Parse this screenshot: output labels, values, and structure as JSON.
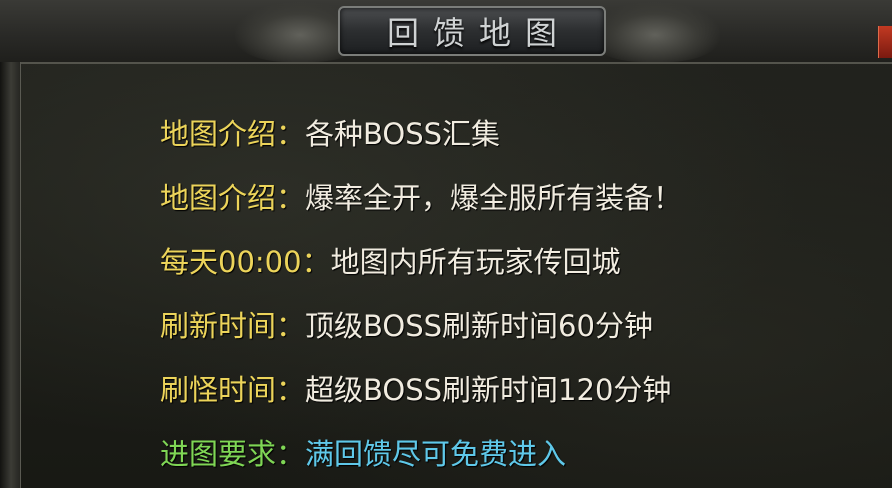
{
  "window": {
    "title": "回馈地图",
    "colors": {
      "label": "#ecd45a",
      "text": "#f1ece0",
      "label_special": "#7fd655",
      "text_special": "#5fc8e9"
    }
  },
  "info_lines": [
    {
      "label": "地图介绍：",
      "value": "各种BOSS汇集"
    },
    {
      "label": "地图介绍：",
      "value": "爆率全开，爆全服所有装备！"
    },
    {
      "label": "每天00:00：",
      "value": "地图内所有玩家传回城"
    },
    {
      "label": "刷新时间：",
      "value": "顶级BOSS刷新时间60分钟"
    },
    {
      "label": "刷怪时间：",
      "value": "超级BOSS刷新时间120分钟"
    },
    {
      "label": "进图要求：",
      "value": "满回馈尽可免费进入"
    }
  ]
}
